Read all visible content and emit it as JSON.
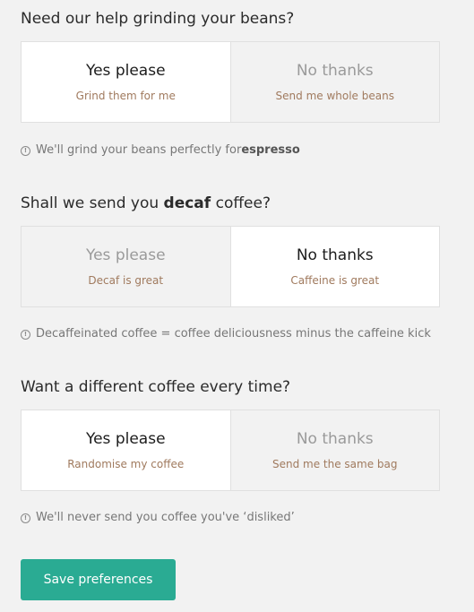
{
  "sections": [
    {
      "question_pre": "Need our help grinding your beans?",
      "question_bold": "",
      "question_post": "",
      "options": [
        {
          "title": "Yes please",
          "subtitle": "Grind them for me",
          "selected": true
        },
        {
          "title": "No thanks",
          "subtitle": "Send me whole beans",
          "selected": false
        }
      ],
      "hint_pre": "We'll grind your beans perfectly for ",
      "hint_bold": "espresso"
    },
    {
      "question_pre": "Shall we send you ",
      "question_bold": "decaf",
      "question_post": " coffee?",
      "options": [
        {
          "title": "Yes please",
          "subtitle": "Decaf is great",
          "selected": false
        },
        {
          "title": "No thanks",
          "subtitle": "Caffeine is great",
          "selected": true
        }
      ],
      "hint_pre": "Decaffeinated coffee = coffee deliciousness minus the caffeine kick",
      "hint_bold": ""
    },
    {
      "question_pre": "Want a different coffee every time?",
      "question_bold": "",
      "question_post": "",
      "options": [
        {
          "title": "Yes please",
          "subtitle": "Randomise my coffee",
          "selected": true
        },
        {
          "title": "No thanks",
          "subtitle": "Send me the same bag",
          "selected": false
        }
      ],
      "hint_pre": "We'll never send you coffee you've ‘disliked’",
      "hint_bold": ""
    }
  ],
  "info_icon_glyph": "!",
  "save_label": "Save preferences",
  "colors": {
    "background": "#f2f2f2",
    "selected_option": "#ffffff",
    "subtitle": "#a07a5e",
    "save_button": "#2aab93"
  }
}
